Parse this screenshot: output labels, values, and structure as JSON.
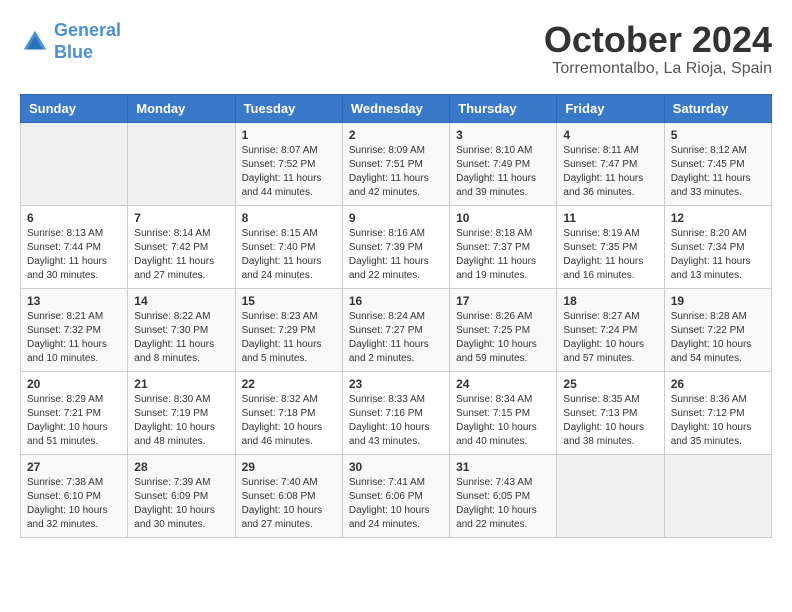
{
  "header": {
    "logo_line1": "General",
    "logo_line2": "Blue",
    "month": "October 2024",
    "location": "Torremontalbo, La Rioja, Spain"
  },
  "weekdays": [
    "Sunday",
    "Monday",
    "Tuesday",
    "Wednesday",
    "Thursday",
    "Friday",
    "Saturday"
  ],
  "weeks": [
    [
      {
        "day": "",
        "sunrise": "",
        "sunset": "",
        "daylight": ""
      },
      {
        "day": "",
        "sunrise": "",
        "sunset": "",
        "daylight": ""
      },
      {
        "day": "1",
        "sunrise": "Sunrise: 8:07 AM",
        "sunset": "Sunset: 7:52 PM",
        "daylight": "Daylight: 11 hours and 44 minutes."
      },
      {
        "day": "2",
        "sunrise": "Sunrise: 8:09 AM",
        "sunset": "Sunset: 7:51 PM",
        "daylight": "Daylight: 11 hours and 42 minutes."
      },
      {
        "day": "3",
        "sunrise": "Sunrise: 8:10 AM",
        "sunset": "Sunset: 7:49 PM",
        "daylight": "Daylight: 11 hours and 39 minutes."
      },
      {
        "day": "4",
        "sunrise": "Sunrise: 8:11 AM",
        "sunset": "Sunset: 7:47 PM",
        "daylight": "Daylight: 11 hours and 36 minutes."
      },
      {
        "day": "5",
        "sunrise": "Sunrise: 8:12 AM",
        "sunset": "Sunset: 7:45 PM",
        "daylight": "Daylight: 11 hours and 33 minutes."
      }
    ],
    [
      {
        "day": "6",
        "sunrise": "Sunrise: 8:13 AM",
        "sunset": "Sunset: 7:44 PM",
        "daylight": "Daylight: 11 hours and 30 minutes."
      },
      {
        "day": "7",
        "sunrise": "Sunrise: 8:14 AM",
        "sunset": "Sunset: 7:42 PM",
        "daylight": "Daylight: 11 hours and 27 minutes."
      },
      {
        "day": "8",
        "sunrise": "Sunrise: 8:15 AM",
        "sunset": "Sunset: 7:40 PM",
        "daylight": "Daylight: 11 hours and 24 minutes."
      },
      {
        "day": "9",
        "sunrise": "Sunrise: 8:16 AM",
        "sunset": "Sunset: 7:39 PM",
        "daylight": "Daylight: 11 hours and 22 minutes."
      },
      {
        "day": "10",
        "sunrise": "Sunrise: 8:18 AM",
        "sunset": "Sunset: 7:37 PM",
        "daylight": "Daylight: 11 hours and 19 minutes."
      },
      {
        "day": "11",
        "sunrise": "Sunrise: 8:19 AM",
        "sunset": "Sunset: 7:35 PM",
        "daylight": "Daylight: 11 hours and 16 minutes."
      },
      {
        "day": "12",
        "sunrise": "Sunrise: 8:20 AM",
        "sunset": "Sunset: 7:34 PM",
        "daylight": "Daylight: 11 hours and 13 minutes."
      }
    ],
    [
      {
        "day": "13",
        "sunrise": "Sunrise: 8:21 AM",
        "sunset": "Sunset: 7:32 PM",
        "daylight": "Daylight: 11 hours and 10 minutes."
      },
      {
        "day": "14",
        "sunrise": "Sunrise: 8:22 AM",
        "sunset": "Sunset: 7:30 PM",
        "daylight": "Daylight: 11 hours and 8 minutes."
      },
      {
        "day": "15",
        "sunrise": "Sunrise: 8:23 AM",
        "sunset": "Sunset: 7:29 PM",
        "daylight": "Daylight: 11 hours and 5 minutes."
      },
      {
        "day": "16",
        "sunrise": "Sunrise: 8:24 AM",
        "sunset": "Sunset: 7:27 PM",
        "daylight": "Daylight: 11 hours and 2 minutes."
      },
      {
        "day": "17",
        "sunrise": "Sunrise: 8:26 AM",
        "sunset": "Sunset: 7:25 PM",
        "daylight": "Daylight: 10 hours and 59 minutes."
      },
      {
        "day": "18",
        "sunrise": "Sunrise: 8:27 AM",
        "sunset": "Sunset: 7:24 PM",
        "daylight": "Daylight: 10 hours and 57 minutes."
      },
      {
        "day": "19",
        "sunrise": "Sunrise: 8:28 AM",
        "sunset": "Sunset: 7:22 PM",
        "daylight": "Daylight: 10 hours and 54 minutes."
      }
    ],
    [
      {
        "day": "20",
        "sunrise": "Sunrise: 8:29 AM",
        "sunset": "Sunset: 7:21 PM",
        "daylight": "Daylight: 10 hours and 51 minutes."
      },
      {
        "day": "21",
        "sunrise": "Sunrise: 8:30 AM",
        "sunset": "Sunset: 7:19 PM",
        "daylight": "Daylight: 10 hours and 48 minutes."
      },
      {
        "day": "22",
        "sunrise": "Sunrise: 8:32 AM",
        "sunset": "Sunset: 7:18 PM",
        "daylight": "Daylight: 10 hours and 46 minutes."
      },
      {
        "day": "23",
        "sunrise": "Sunrise: 8:33 AM",
        "sunset": "Sunset: 7:16 PM",
        "daylight": "Daylight: 10 hours and 43 minutes."
      },
      {
        "day": "24",
        "sunrise": "Sunrise: 8:34 AM",
        "sunset": "Sunset: 7:15 PM",
        "daylight": "Daylight: 10 hours and 40 minutes."
      },
      {
        "day": "25",
        "sunrise": "Sunrise: 8:35 AM",
        "sunset": "Sunset: 7:13 PM",
        "daylight": "Daylight: 10 hours and 38 minutes."
      },
      {
        "day": "26",
        "sunrise": "Sunrise: 8:36 AM",
        "sunset": "Sunset: 7:12 PM",
        "daylight": "Daylight: 10 hours and 35 minutes."
      }
    ],
    [
      {
        "day": "27",
        "sunrise": "Sunrise: 7:38 AM",
        "sunset": "Sunset: 6:10 PM",
        "daylight": "Daylight: 10 hours and 32 minutes."
      },
      {
        "day": "28",
        "sunrise": "Sunrise: 7:39 AM",
        "sunset": "Sunset: 6:09 PM",
        "daylight": "Daylight: 10 hours and 30 minutes."
      },
      {
        "day": "29",
        "sunrise": "Sunrise: 7:40 AM",
        "sunset": "Sunset: 6:08 PM",
        "daylight": "Daylight: 10 hours and 27 minutes."
      },
      {
        "day": "30",
        "sunrise": "Sunrise: 7:41 AM",
        "sunset": "Sunset: 6:06 PM",
        "daylight": "Daylight: 10 hours and 24 minutes."
      },
      {
        "day": "31",
        "sunrise": "Sunrise: 7:43 AM",
        "sunset": "Sunset: 6:05 PM",
        "daylight": "Daylight: 10 hours and 22 minutes."
      },
      {
        "day": "",
        "sunrise": "",
        "sunset": "",
        "daylight": ""
      },
      {
        "day": "",
        "sunrise": "",
        "sunset": "",
        "daylight": ""
      }
    ]
  ]
}
